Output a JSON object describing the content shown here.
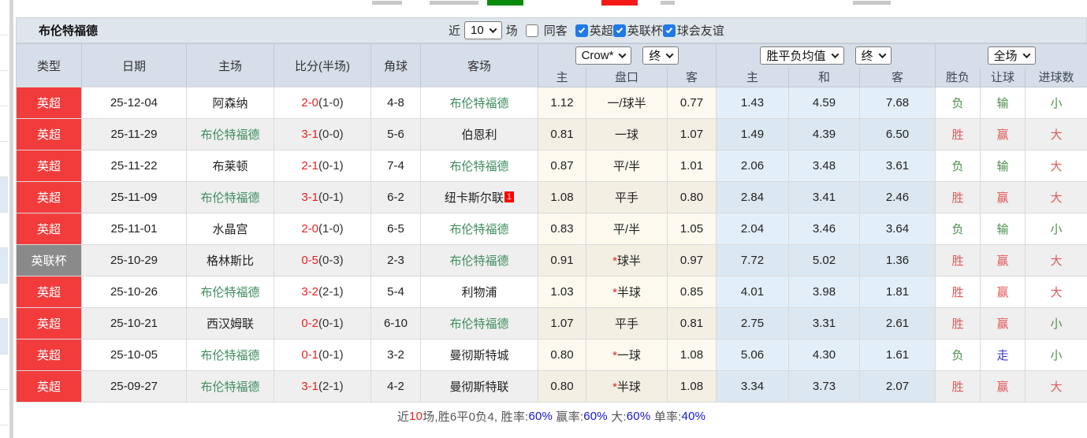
{
  "title": "布伦特福德",
  "filter": {
    "near_label": "近",
    "count": "10",
    "games_label": "场",
    "checkboxes": [
      {
        "label": "同客",
        "checked": false
      },
      {
        "label": "英超",
        "checked": true
      },
      {
        "label": "英联杯",
        "checked": true
      },
      {
        "label": "球会友谊",
        "checked": true
      }
    ]
  },
  "header": {
    "left_columns": [
      "类型",
      "日期",
      "主场",
      "比分(半场)",
      "角球",
      "客场"
    ],
    "selects": {
      "odds": "Crow*",
      "odds_state": "终",
      "avg": "胜平负均值",
      "avg_state": "终",
      "scope": "全场"
    },
    "sub_columns": [
      "主",
      "盘口",
      "客",
      "主",
      "和",
      "客",
      "胜负",
      "让球",
      "进球数"
    ]
  },
  "rows": [
    {
      "league": "英超",
      "badge": "red",
      "date": "25-12-04",
      "home": "阿森纳",
      "home_focus": false,
      "score": "2-0",
      "half": "(1-0)",
      "corner": "4-8",
      "away": "布伦特福德",
      "away_focus": true,
      "away_sup": "",
      "odds_home": "1.12",
      "handicap": "一/球半",
      "odds_away": "0.77",
      "avg_home": "1.43",
      "avg_draw": "4.59",
      "avg_away": "7.68",
      "result": "负",
      "result_c": "g",
      "spread": "输",
      "spread_c": "g",
      "goals": "小",
      "goals_c": "g"
    },
    {
      "league": "英超",
      "badge": "red",
      "date": "25-11-29",
      "home": "布伦特福德",
      "home_focus": true,
      "score": "3-1",
      "half": "(0-0)",
      "corner": "5-6",
      "away": "伯恩利",
      "away_focus": false,
      "away_sup": "",
      "odds_home": "0.81",
      "handicap": "一球",
      "odds_away": "1.07",
      "avg_home": "1.49",
      "avg_draw": "4.39",
      "avg_away": "6.50",
      "result": "胜",
      "result_c": "r",
      "spread": "赢",
      "spread_c": "r",
      "goals": "大",
      "goals_c": "r"
    },
    {
      "league": "英超",
      "badge": "red",
      "date": "25-11-22",
      "home": "布莱顿",
      "home_focus": false,
      "score": "2-1",
      "half": "(0-1)",
      "corner": "7-4",
      "away": "布伦特福德",
      "away_focus": true,
      "away_sup": "",
      "odds_home": "0.87",
      "handicap": "平/半",
      "odds_away": "1.01",
      "avg_home": "2.06",
      "avg_draw": "3.48",
      "avg_away": "3.61",
      "result": "负",
      "result_c": "g",
      "spread": "输",
      "spread_c": "g",
      "goals": "大",
      "goals_c": "r"
    },
    {
      "league": "英超",
      "badge": "red",
      "date": "25-11-09",
      "home": "布伦特福德",
      "home_focus": true,
      "score": "3-1",
      "half": "(0-1)",
      "corner": "6-2",
      "away": "纽卡斯尔联",
      "away_focus": false,
      "away_sup": "1",
      "odds_home": "1.08",
      "handicap": "平手",
      "odds_away": "0.80",
      "avg_home": "2.84",
      "avg_draw": "3.41",
      "avg_away": "2.46",
      "result": "胜",
      "result_c": "r",
      "spread": "赢",
      "spread_c": "r",
      "goals": "大",
      "goals_c": "r"
    },
    {
      "league": "英超",
      "badge": "red",
      "date": "25-11-01",
      "home": "水晶宫",
      "home_focus": false,
      "score": "2-0",
      "half": "(1-0)",
      "corner": "6-5",
      "away": "布伦特福德",
      "away_focus": true,
      "away_sup": "",
      "odds_home": "0.83",
      "handicap": "平/半",
      "odds_away": "1.05",
      "avg_home": "2.04",
      "avg_draw": "3.46",
      "avg_away": "3.64",
      "result": "负",
      "result_c": "g",
      "spread": "输",
      "spread_c": "g",
      "goals": "小",
      "goals_c": "g"
    },
    {
      "league": "英联杯",
      "badge": "gray",
      "date": "25-10-29",
      "home": "格林斯比",
      "home_focus": false,
      "score": "0-5",
      "half": "(0-3)",
      "corner": "2-3",
      "away": "布伦特福德",
      "away_focus": true,
      "away_sup": "",
      "odds_home": "0.91",
      "handicap": "*球半",
      "odds_away": "0.97",
      "avg_home": "7.72",
      "avg_draw": "5.02",
      "avg_away": "1.36",
      "result": "胜",
      "result_c": "r",
      "spread": "赢",
      "spread_c": "r",
      "goals": "大",
      "goals_c": "r"
    },
    {
      "league": "英超",
      "badge": "red",
      "date": "25-10-26",
      "home": "布伦特福德",
      "home_focus": true,
      "score": "3-2",
      "half": "(2-1)",
      "corner": "5-4",
      "away": "利物浦",
      "away_focus": false,
      "away_sup": "",
      "odds_home": "1.03",
      "handicap": "*半球",
      "odds_away": "0.85",
      "avg_home": "4.01",
      "avg_draw": "3.98",
      "avg_away": "1.81",
      "result": "胜",
      "result_c": "r",
      "spread": "赢",
      "spread_c": "r",
      "goals": "大",
      "goals_c": "r"
    },
    {
      "league": "英超",
      "badge": "red",
      "date": "25-10-21",
      "home": "西汉姆联",
      "home_focus": false,
      "score": "0-2",
      "half": "(0-1)",
      "corner": "6-10",
      "away": "布伦特福德",
      "away_focus": true,
      "away_sup": "",
      "odds_home": "1.07",
      "handicap": "平手",
      "odds_away": "0.81",
      "avg_home": "2.75",
      "avg_draw": "3.31",
      "avg_away": "2.61",
      "result": "胜",
      "result_c": "r",
      "spread": "赢",
      "spread_c": "r",
      "goals": "小",
      "goals_c": "g"
    },
    {
      "league": "英超",
      "badge": "red",
      "date": "25-10-05",
      "home": "布伦特福德",
      "home_focus": true,
      "score": "0-1",
      "half": "(0-1)",
      "corner": "3-2",
      "away": "曼彻斯特城",
      "away_focus": false,
      "away_sup": "",
      "odds_home": "0.80",
      "handicap": "*一球",
      "odds_away": "1.08",
      "avg_home": "5.06",
      "avg_draw": "4.30",
      "avg_away": "1.61",
      "result": "负",
      "result_c": "g",
      "spread": "走",
      "spread_c": "b",
      "goals": "小",
      "goals_c": "g"
    },
    {
      "league": "英超",
      "badge": "red",
      "date": "25-09-27",
      "home": "布伦特福德",
      "home_focus": true,
      "score": "3-1",
      "half": "(2-1)",
      "corner": "4-2",
      "away": "曼彻斯特联",
      "away_focus": false,
      "away_sup": "",
      "odds_home": "0.80",
      "handicap": "*半球",
      "odds_away": "1.08",
      "avg_home": "3.34",
      "avg_draw": "3.73",
      "avg_away": "2.07",
      "result": "胜",
      "result_c": "r",
      "spread": "赢",
      "spread_c": "r",
      "goals": "大",
      "goals_c": "r"
    }
  ],
  "summary": {
    "prefix": "近",
    "count": "10",
    "record": "场,胜6平0负4, ",
    "stats": [
      {
        "label": "胜率:",
        "value": "60%"
      },
      {
        "label": " 赢率:",
        "value": "60%"
      },
      {
        "label": " 大:",
        "value": "60%"
      },
      {
        "label": " 单率:",
        "value": "40%"
      }
    ]
  },
  "colors": {
    "badge_red": "#f23b3b",
    "badge_gray": "#8a8a8a",
    "team_green": "#3e8e5e",
    "score_red": "#e62222",
    "result_red": "#e05a5a",
    "result_green": "#4e8d4e",
    "result_blue": "#3939cc",
    "summary_value_blue": "#1414d2",
    "checkbox_blue": "#2079e8",
    "header_bg": "#d6dfe9",
    "title_bar_bg": "#dee5ec"
  }
}
